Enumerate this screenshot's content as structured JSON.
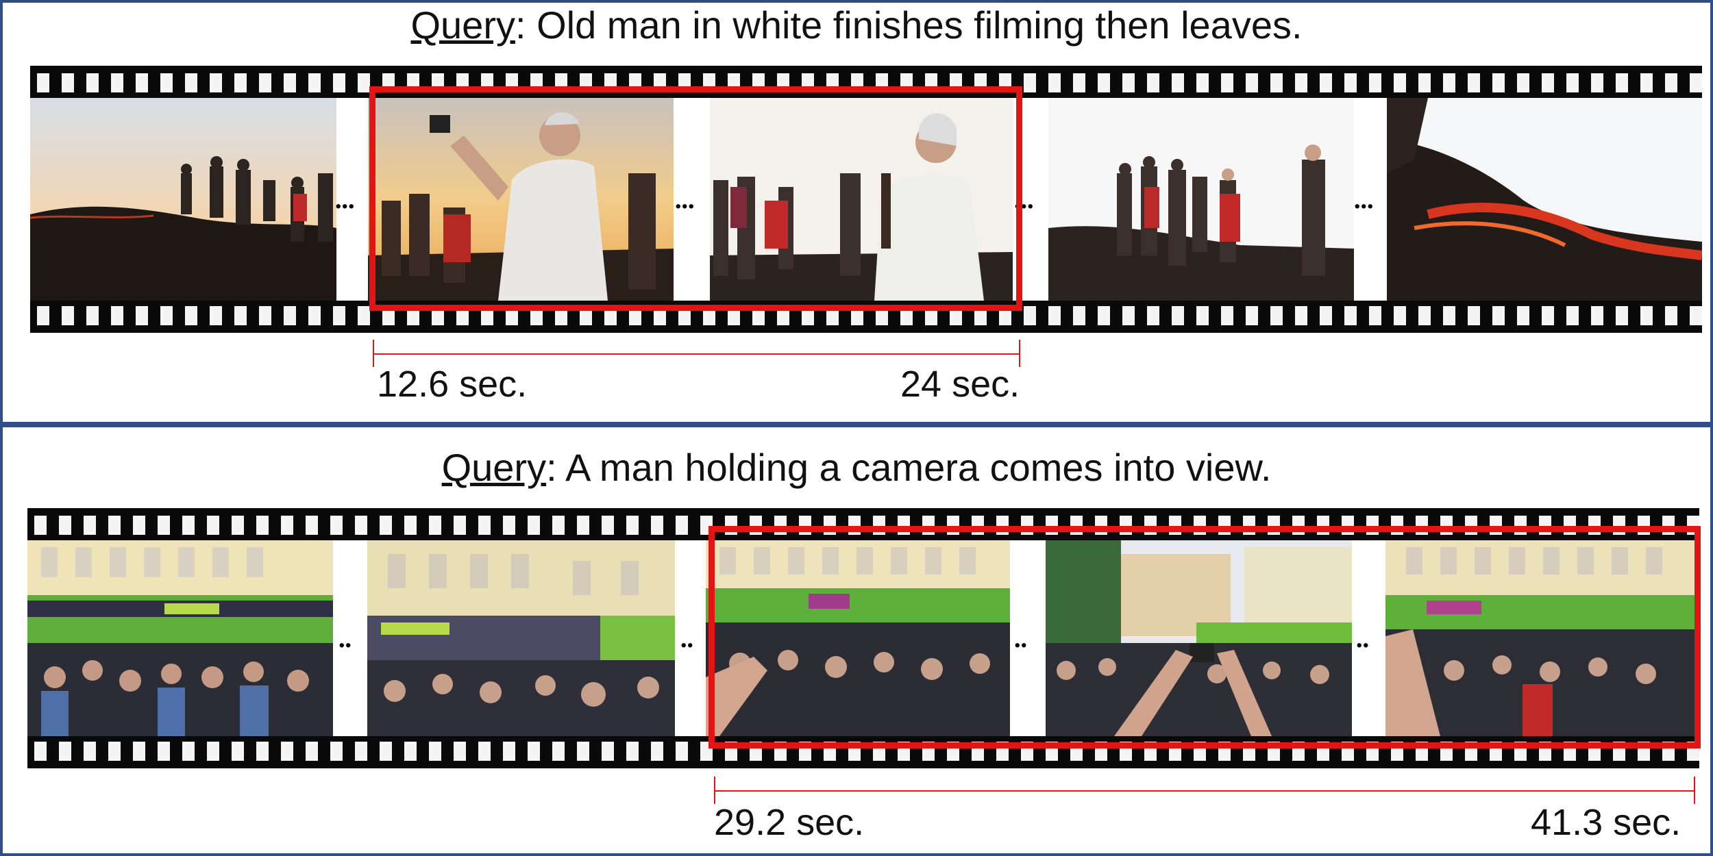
{
  "panels": [
    {
      "query_label": "Query",
      "query_text": ": Old man in white finishes filming then leaves.",
      "start_label": "12.6 sec.",
      "end_label": "24 sec.",
      "ellipsis": "..."
    },
    {
      "query_label": "Query",
      "query_text": ": A man holding a camera comes into view.",
      "start_label": "29.2 sec.",
      "end_label": "41.3 sec.",
      "ellipsis": ".."
    }
  ],
  "colors": {
    "border": "#2f4f86",
    "highlight": "#e31414",
    "film": "#0a0a0a"
  },
  "icons": [
    "video-frame-image"
  ]
}
